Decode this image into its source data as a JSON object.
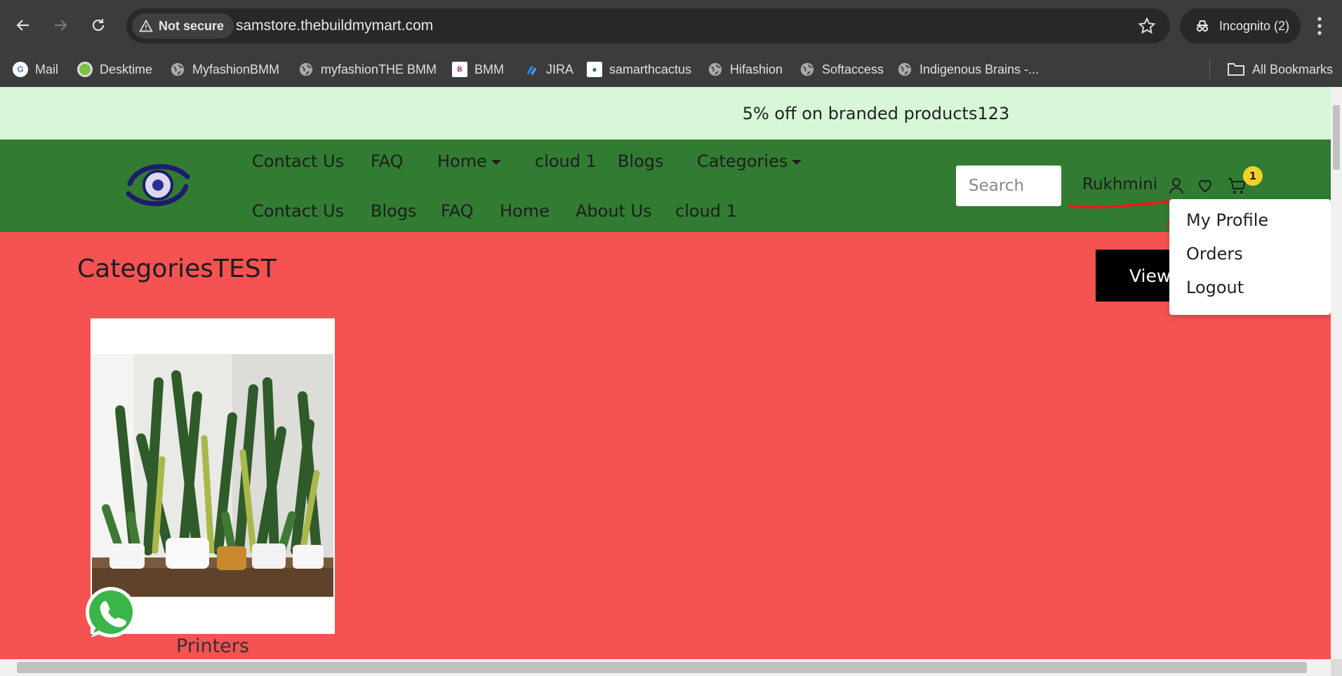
{
  "browser": {
    "not_secure_label": "Not secure",
    "url": "samstore.thebuildmymart.com",
    "incognito_label": "Incognito (2)",
    "bookmarks": [
      {
        "label": "Mail",
        "icon": "google-icon"
      },
      {
        "label": "Desktime",
        "icon": "desktime-icon"
      },
      {
        "label": "MyfashionBMM",
        "icon": "globe-icon"
      },
      {
        "label": "myfashionTHE BMM",
        "icon": "globe-icon"
      },
      {
        "label": "BMM",
        "icon": "bmm-icon"
      },
      {
        "label": "JIRA",
        "icon": "jira-icon"
      },
      {
        "label": "samarthcactus",
        "icon": "cactus-icon"
      },
      {
        "label": "Hifashion",
        "icon": "globe-icon"
      },
      {
        "label": "Softaccess",
        "icon": "globe-icon"
      },
      {
        "label": "Indigenous Brains -...",
        "icon": "globe-icon"
      }
    ],
    "all_bookmarks_label": "All Bookmarks"
  },
  "promo": {
    "text": "5% off on branded products123"
  },
  "header": {
    "nav_row1": [
      {
        "label": "Contact Us"
      },
      {
        "label": "FAQ"
      },
      {
        "label": "Home",
        "dropdown": true
      },
      {
        "label": "cloud 1"
      },
      {
        "label": "Blogs"
      },
      {
        "label": "Categories",
        "dropdown": true
      }
    ],
    "nav_row2": [
      {
        "label": "Contact Us"
      },
      {
        "label": "Blogs"
      },
      {
        "label": "FAQ"
      },
      {
        "label": "Home"
      },
      {
        "label": "About Us"
      },
      {
        "label": "cloud 1"
      }
    ],
    "search_placeholder": "Search",
    "user_name": "Rukhmini",
    "cart_count": "1"
  },
  "user_menu": {
    "items": [
      "My Profile",
      "Orders",
      "Logout"
    ]
  },
  "section": {
    "title": "CategoriesTEST",
    "view_button_label": "View"
  },
  "categories": [
    {
      "name": "Printers"
    }
  ],
  "colors": {
    "promo_bg": "#d7f7d8",
    "header_bg": "#317c32",
    "page_bg": "#f55252",
    "badge": "#f2d22a",
    "annotation": "#e51b1b"
  }
}
